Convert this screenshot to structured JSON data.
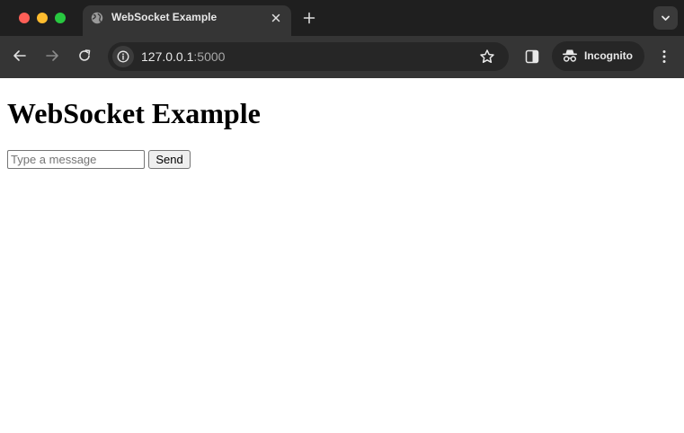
{
  "browser": {
    "tab": {
      "title": "WebSocket Example",
      "favicon": "globe-icon"
    },
    "address": {
      "host": "127.0.0.1",
      "port": ":5000"
    },
    "profile_label": "Incognito",
    "colors": {
      "chrome": "#353535",
      "tab_strip": "#1f1f1f",
      "omnibox": "#262626",
      "text": "#e8e8e8"
    }
  },
  "page": {
    "heading": "WebSocket Example",
    "message_input": {
      "placeholder": "Type a message",
      "value": ""
    },
    "send_label": "Send"
  }
}
